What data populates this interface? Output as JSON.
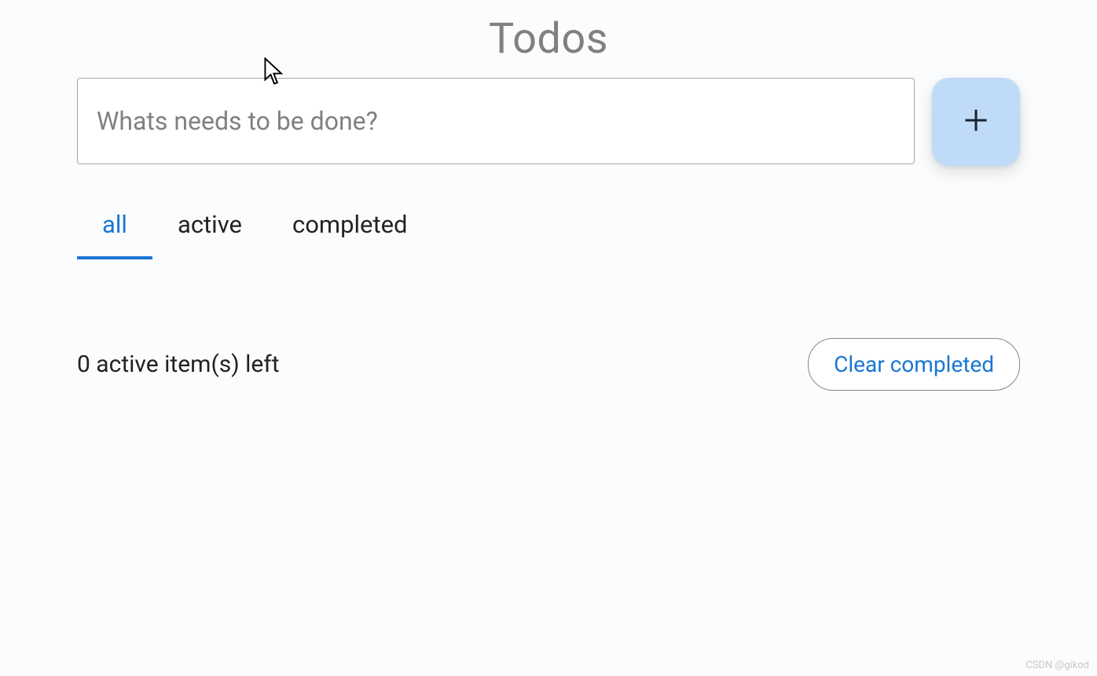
{
  "title": "Todos",
  "input": {
    "placeholder": "Whats needs to be done?",
    "value": ""
  },
  "tabs": {
    "all": "all",
    "active": "active",
    "completed": "completed",
    "selected": "all"
  },
  "status": {
    "count": 0,
    "text": "0 active item(s) left"
  },
  "clear_button_label": "Clear completed",
  "watermark": "CSDN @gikod",
  "colors": {
    "accent": "#1976d2",
    "add_button_bg": "#bfdbf7",
    "title_color": "#808080",
    "border": "#a7a7a7"
  }
}
